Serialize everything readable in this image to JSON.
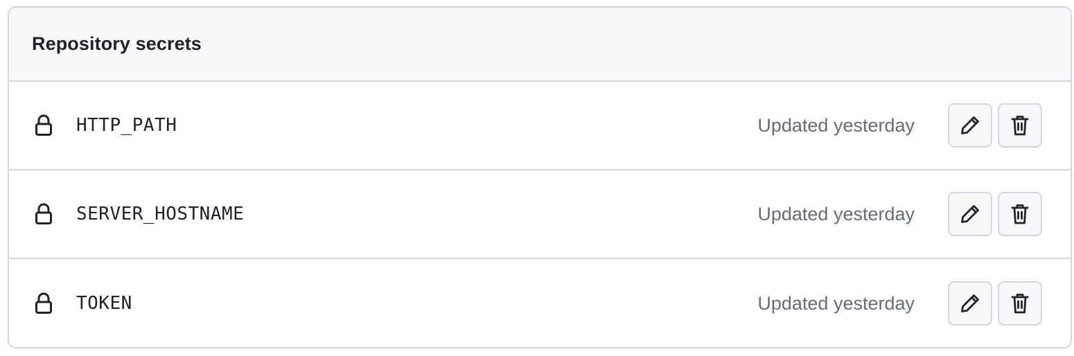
{
  "panel": {
    "title": "Repository secrets"
  },
  "secrets": [
    {
      "name": "HTTP_PATH",
      "updated": "Updated yesterday",
      "icon": "lock-icon"
    },
    {
      "name": "SERVER_HOSTNAME",
      "updated": "Updated yesterday",
      "icon": "lock-icon"
    },
    {
      "name": "TOKEN",
      "updated": "Updated yesterday",
      "icon": "lock-icon"
    }
  ],
  "actions": {
    "edit_icon": "pencil-icon",
    "delete_icon": "trash-icon"
  },
  "colors": {
    "border": "#d0d7de",
    "header_bg": "#f6f8fa",
    "text": "#1f2328",
    "muted_text": "#656d76"
  }
}
